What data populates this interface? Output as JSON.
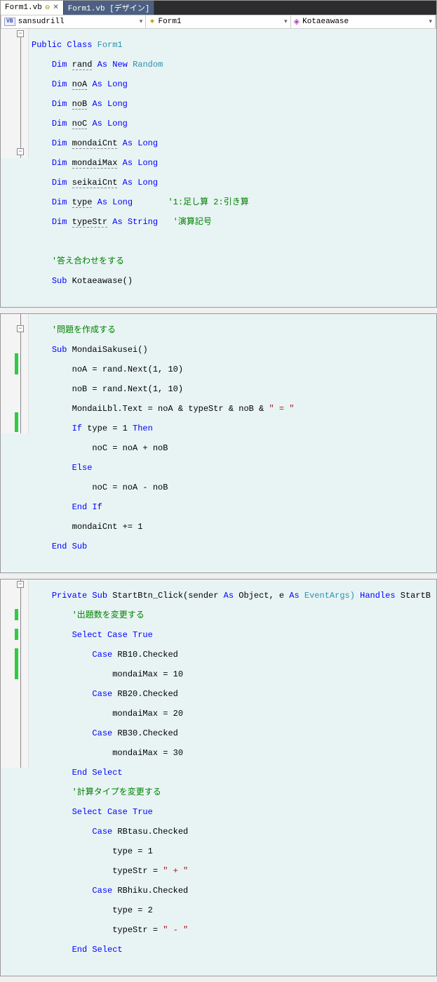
{
  "tabs": [
    {
      "label": "Form1.vb",
      "pinned": true,
      "closable": true,
      "active": true
    },
    {
      "label": "Form1.vb [デザイン]",
      "pinned": false,
      "closable": false,
      "active": false
    }
  ],
  "nav": {
    "project": {
      "icon": "VB",
      "text": "sansudrill"
    },
    "class": {
      "text": "Form1"
    },
    "method": {
      "text": "Kotaeawase"
    }
  },
  "block1": {
    "l1": {
      "a": "Public Class",
      "b": "Form1"
    },
    "l2": {
      "a": "Dim",
      "b": "rand",
      "c": "As New",
      "d": "Random"
    },
    "l3": {
      "a": "Dim",
      "b": "noA",
      "c": "As Long"
    },
    "l4": {
      "a": "Dim",
      "b": "noB",
      "c": "As Long"
    },
    "l5": {
      "a": "Dim",
      "b": "noC",
      "c": "As Long"
    },
    "l6": {
      "a": "Dim",
      "b": "mondaiCnt",
      "c": "As Long"
    },
    "l7": {
      "a": "Dim",
      "b": "mondaiMax",
      "c": "As Long"
    },
    "l8": {
      "a": "Dim",
      "b": "seikaiCnt",
      "c": "As Long"
    },
    "l9": {
      "a": "Dim",
      "b": "type",
      "c": "As Long",
      "d": "'1:足し算 2:引き算"
    },
    "l10": {
      "a": "Dim",
      "b": "typeStr",
      "c": "As String",
      "d": "'演算記号"
    },
    "l11": "",
    "l12": {
      "a": "'答え合わせをする"
    },
    "l13": {
      "a": "Sub",
      "b": "Kotaeawase()"
    }
  },
  "block2": {
    "l1": {
      "a": "'問題を作成する"
    },
    "l2": {
      "a": "Sub",
      "b": "MondaiSakusei()"
    },
    "l3": "    noA = rand.Next(1, 10)",
    "l4": "    noB = rand.Next(1, 10)",
    "l5": {
      "a": "    MondaiLbl.Text = noA & typeStr & noB & ",
      "b": "\" = \""
    },
    "l6": {
      "a": "If",
      "b": " type = 1 ",
      "c": "Then"
    },
    "l7": "        noC = noA + noB",
    "l8": {
      "a": "Else"
    },
    "l9": "        noC = noA - noB",
    "l10": {
      "a": "End If"
    },
    "l11": "    mondaiCnt += 1",
    "l12": {
      "a": "End Sub"
    }
  },
  "block3": {
    "l1": {
      "a": "Private Sub",
      "b": " StartBtn_Click(sender ",
      "c": "As",
      "d": " Object, e ",
      "e": "As",
      "f": " EventArgs) ",
      "g": "Handles",
      "h": " StartB"
    },
    "l2": {
      "a": "'出題数を変更する"
    },
    "l3": {
      "a": "Select Case",
      "b": " True"
    },
    "l4": {
      "a": "Case",
      "b": " RB10.Checked"
    },
    "l5": "            mondaiMax = 10",
    "l6": {
      "a": "Case",
      "b": " RB20.Checked"
    },
    "l7": "            mondaiMax = 20",
    "l8": {
      "a": "Case",
      "b": " RB30.Checked"
    },
    "l9": "            mondaiMax = 30",
    "l10": {
      "a": "End Select"
    },
    "l11": {
      "a": "'計算タイプを変更する"
    },
    "l12": {
      "a": "Select Case",
      "b": " True"
    },
    "l13": {
      "a": "Case",
      "b": " RBtasu.Checked"
    },
    "l14": "            type = 1",
    "l15": {
      "a": "            typeStr = ",
      "b": "\" + \""
    },
    "l16": {
      "a": "Case",
      "b": " RBhiku.Checked"
    },
    "l17": "            type = 2",
    "l18": {
      "a": "            typeStr = ",
      "b": "\" - \""
    },
    "l19": {
      "a": "End Select"
    }
  }
}
